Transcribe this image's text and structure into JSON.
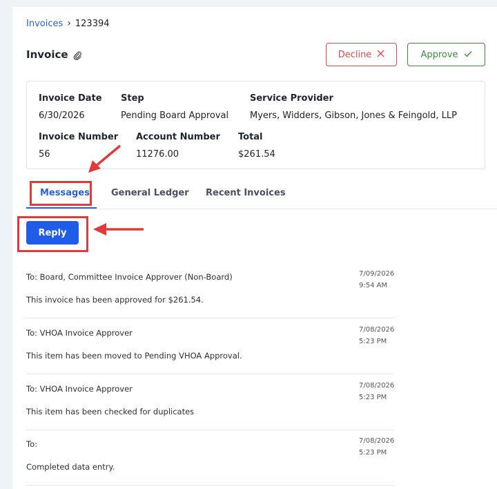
{
  "breadcrumb": {
    "parent": "Invoices",
    "separator": "›",
    "current": "123394"
  },
  "header": {
    "title": "Invoice",
    "decline_label": "Decline",
    "approve_label": "Approve"
  },
  "details": {
    "invoice_date_label": "Invoice Date",
    "invoice_date": "6/30/2026",
    "step_label": "Step",
    "step": "Pending Board Approval",
    "provider_label": "Service Provider",
    "provider": "Myers, Widders, Gibson, Jones & Feingold, LLP",
    "invoice_number_label": "Invoice Number",
    "invoice_number": "56",
    "account_number_label": "Account Number",
    "account_number": "11276.00",
    "total_label": "Total",
    "total": "$261.54"
  },
  "tabs": [
    {
      "label": "Messages",
      "active": true
    },
    {
      "label": "General Ledger",
      "active": false
    },
    {
      "label": "Recent Invoices",
      "active": false
    }
  ],
  "reply_label": "Reply",
  "messages": [
    {
      "to": "To: Board, Committee Invoice Approver (Non-Board)",
      "body": "This invoice has been approved for $261.54.",
      "date": "7/09/2026",
      "time": "9:54 AM"
    },
    {
      "to": "To: VHOA Invoice Approver",
      "body": "This item has been moved to Pending VHOA Approval.",
      "date": "7/08/2026",
      "time": "5:23 PM"
    },
    {
      "to": "To: VHOA Invoice Approver",
      "body": "This item has been checked for duplicates",
      "date": "7/08/2026",
      "time": "5:23 PM"
    },
    {
      "to": "To:",
      "body": "Completed data entry.",
      "date": "7/08/2026",
      "time": "5:23 PM"
    }
  ],
  "colors": {
    "accent": "#1f5ce8",
    "decline": "#e04a4a",
    "approve": "#3d8a3d",
    "annotation": "#e03a3a"
  },
  "icons": {
    "attachment": "paperclip-icon",
    "decline": "x-icon",
    "approve": "check-icon"
  }
}
